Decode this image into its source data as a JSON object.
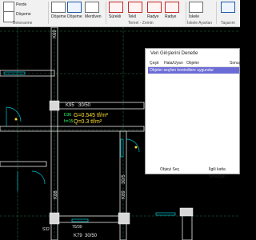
{
  "ribbon": {
    "buttons": [
      {
        "label": "Perde"
      },
      {
        "label": "Döşeme"
      },
      {
        "label": "Döşeme",
        "label2": ""
      },
      {
        "label": "Döşeme",
        "label2": "Kanalı"
      },
      {
        "label": "Merdiven"
      },
      {
        "label": "Sürekli",
        "label2": "Temel"
      },
      {
        "label": "Tekil",
        "label2": "Temel"
      },
      {
        "label": "Radye"
      },
      {
        "label": "Radye",
        "label2": "Kanalı"
      },
      {
        "label": "İskele",
        "label2": "Makrosu"
      }
    ],
    "groups": [
      "Betonarme",
      "Temel - Zemin",
      "İskele Ayarları",
      "Taşarım"
    ]
  },
  "drawing": {
    "labels": [
      "K69",
      "K95",
      "30/50",
      "G=0.545 tf/m²",
      "Q=0.3 tf/m²",
      "D36",
      "h=15",
      "K88",
      "K89",
      "30/5",
      "K79",
      "30/50",
      "70/30",
      "S32"
    ]
  },
  "dialog": {
    "title": "Veri Girişlerini Denetle",
    "columns": [
      "Çeşit",
      "Hata/Uyarı",
      "Objeler",
      "Sonuç"
    ],
    "rows": [
      {
        "text": "Objeler seçilen kontrollere uygundur"
      }
    ],
    "buttons": [
      "Objeyi Seç",
      "İlgili katta Sonuçları"
    ]
  },
  "colors": {
    "grid": "#1f6f3f",
    "beam": "#e6e6e6",
    "cyan": "#00c8d8",
    "yellow_text": "#ffe033",
    "green_text": "#33ff66",
    "selection": "#6b6bd6"
  }
}
